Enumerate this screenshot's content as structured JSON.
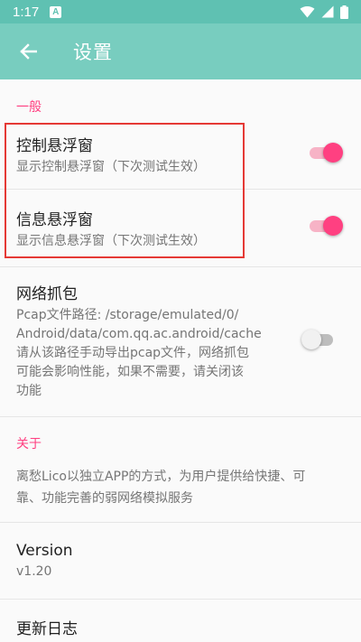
{
  "status_bar": {
    "time": "1:17",
    "notification_letter": "A",
    "icons": [
      "wifi-icon",
      "signal-icon",
      "battery-icon"
    ]
  },
  "app_bar": {
    "title": "设置",
    "back_icon": "arrow-back-icon"
  },
  "colors": {
    "status_bar": "#5fc1b2",
    "app_bar": "#78cdbf",
    "accent": "#ff4081",
    "highlight_box": "#e53935"
  },
  "general": {
    "header": "一般",
    "float_control": {
      "title": "控制悬浮窗",
      "summary": "显示控制悬浮窗（下次测试生效）",
      "enabled": true
    },
    "float_info": {
      "title": "信息悬浮窗",
      "summary": "显示信息悬浮窗（下次测试生效）",
      "enabled": true
    },
    "packet_capture": {
      "title": "网络抓包",
      "summary_lines": [
        "Pcap文件路径: /storage/emulated/0/",
        "Android/data/com.qq.ac.android/cache",
        "请从该路径手动导出pcap文件，网络抓包",
        "可能会影响性能，如果不需要，请关闭该",
        "功能"
      ],
      "enabled": false
    }
  },
  "about": {
    "header": "关于",
    "description_lines": [
      "离愁Lico以独立APP的方式，为用户提供给快捷、可",
      "靠、功能完善的弱网络模拟服务"
    ],
    "version": {
      "title": "Version",
      "value": "v1.20"
    },
    "changelog": {
      "title": "更新日志"
    }
  }
}
